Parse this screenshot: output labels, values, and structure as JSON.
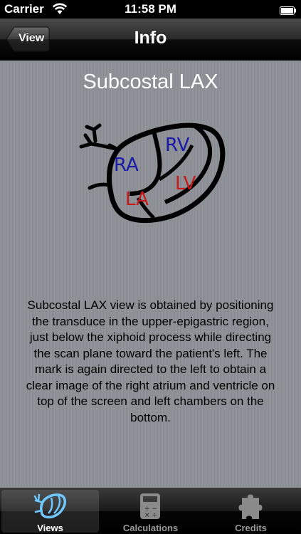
{
  "status_bar": {
    "carrier": "Carrier",
    "time": "11:58 PM"
  },
  "nav": {
    "title": "Info",
    "back_label": "View"
  },
  "content": {
    "view_title": "Subcostal LAX",
    "diagram_labels": {
      "ra": "RA",
      "rv": "RV",
      "la": "LA",
      "lv": "LV"
    },
    "description": "Subcostal LAX view is obtained by positioning the transduce in the upper-epigastric region, just below the xiphoid process while directing the scan plane toward the patient's left. The mark is again directed to the left to obtain a clear image of the right atrium and ventricle on top of the screen and left chambers on the bottom."
  },
  "tabs": [
    {
      "label": "Views",
      "icon": "heart-views-icon",
      "active": true
    },
    {
      "label": "Calculations",
      "icon": "calculator-icon",
      "active": false
    },
    {
      "label": "Credits",
      "icon": "puzzle-piece-icon",
      "active": false
    }
  ],
  "colors": {
    "right_chamber": "#1a1aa8",
    "left_chamber": "#c81818",
    "background": "#8d9096"
  }
}
